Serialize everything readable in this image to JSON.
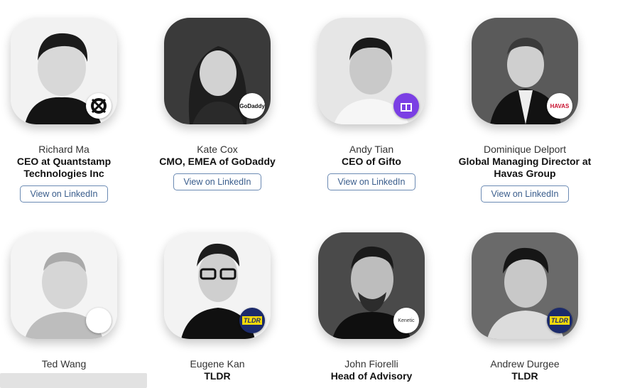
{
  "speakers": [
    {
      "name": "Richard Ma",
      "title": "CEO at Quantstamp Technologies Inc",
      "button": "View on LinkedIn",
      "badge": "quantstamp-logo-icon"
    },
    {
      "name": "Kate Cox",
      "title": "CMO, EMEA of GoDaddy",
      "button": "View on LinkedIn",
      "badge": "godaddy-logo-icon",
      "badge_text": "GoDaddy"
    },
    {
      "name": "Andy Tian",
      "title": "CEO of Gifto",
      "button": "View on LinkedIn",
      "badge": "gifto-logo-icon"
    },
    {
      "name": "Dominique Delport",
      "title": "Global Managing Director at Havas Group",
      "button": "View on LinkedIn",
      "badge": "havas-logo-icon",
      "badge_text": "HAVAS"
    },
    {
      "name": "Ted Wang",
      "title": "",
      "badge": "company-logo-icon"
    },
    {
      "name": "Eugene Kan",
      "title": "TLDR",
      "badge": "tldr-logo-icon",
      "badge_text": "TLDR"
    },
    {
      "name": "John Fiorelli",
      "title": "Head of Advisory",
      "badge": "kenetic-logo-icon",
      "badge_text": "Kenetic"
    },
    {
      "name": "Andrew Durgee",
      "title": "TLDR",
      "badge": "tldr-logo-icon",
      "badge_text": "TLDR"
    }
  ],
  "colors": {
    "link": "#3a5d8c",
    "gifto": "#7b3fe4",
    "havas": "#c8102e",
    "tldr_bg": "#1c2b6b",
    "tldr_fg": "#f5d90a"
  }
}
